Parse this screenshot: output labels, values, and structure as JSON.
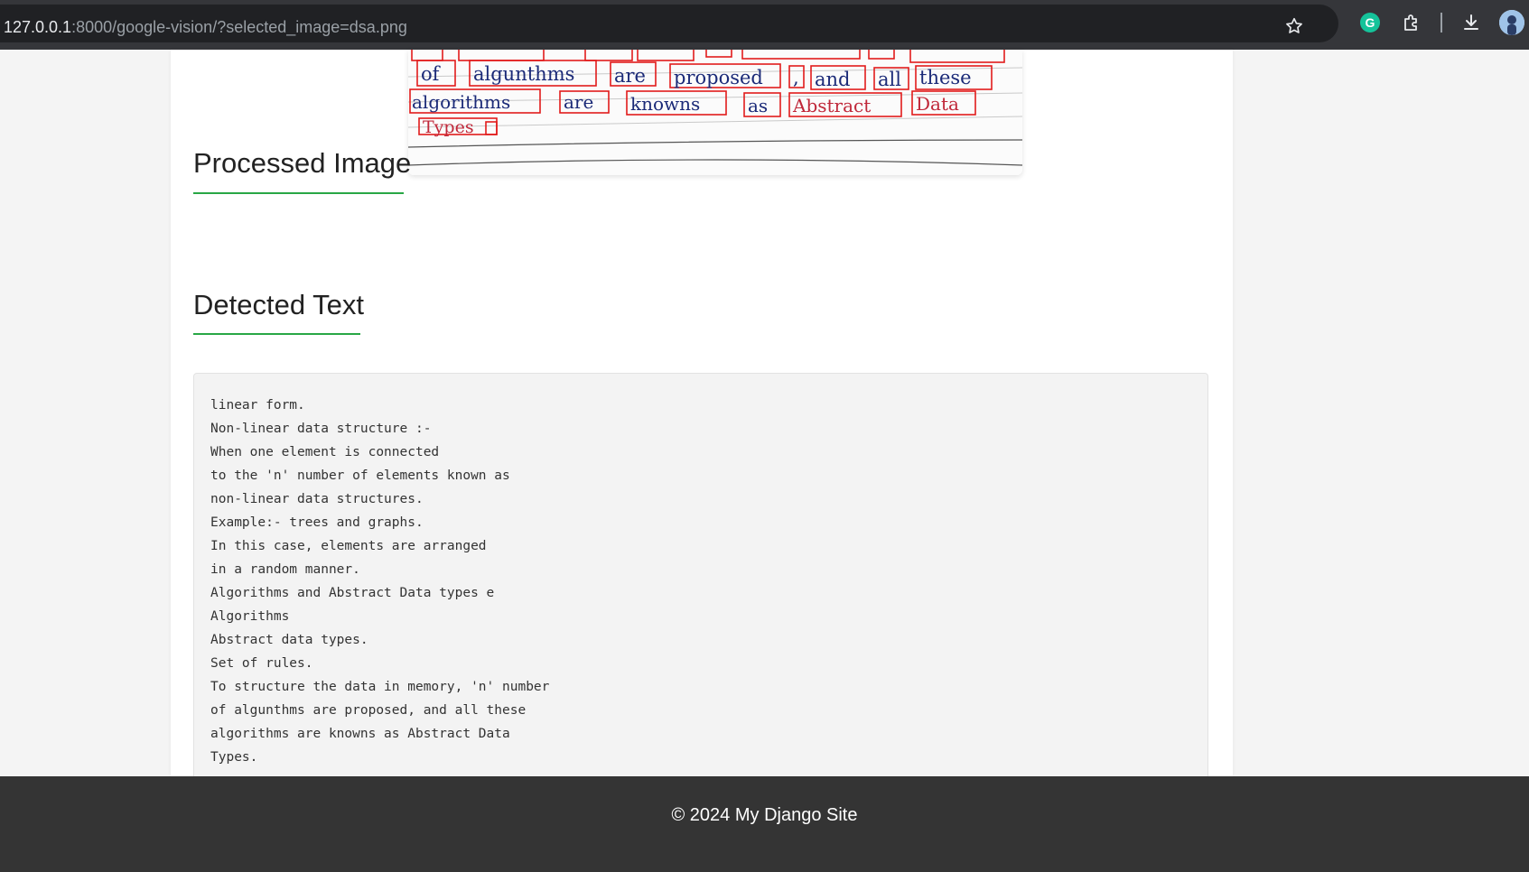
{
  "browser": {
    "url_host": "127.0.0.1",
    "url_rest": ":8000/google-vision/?selected_image=dsa.png"
  },
  "processed_image": {
    "heading": "Processed Image",
    "handwriting_lines": [
      [
        "of",
        "algunthms",
        "are",
        "proposed",
        ",",
        "and",
        "all",
        "these"
      ],
      [
        "algorithms",
        "are",
        "knowns",
        "as",
        "Abstract",
        "Data"
      ],
      [
        "Types"
      ]
    ],
    "box_color": "#e21b1b",
    "ink_color": "#1b2a78"
  },
  "detected_text": {
    "heading": "Detected Text",
    "lines": [
      "linear form.",
      "Non-linear data structure :-",
      "When one element is connected",
      "to the 'n' number of elements known as",
      "non-linear data structures.",
      "Example:- trees and graphs.",
      "In this case, elements are arranged",
      "in a random manner.",
      "Algorithms and Abstract Data types e",
      "Algorithms",
      "Abstract data types.",
      "Set of rules.",
      "To structure the data in memory, 'n' number",
      "of algunthms are proposed, and all these",
      "algorithms are knowns as Abstract Data",
      "Types."
    ]
  },
  "footer": {
    "text": "© 2024 My Django Site"
  },
  "colors": {
    "accent_underline": "#28a745",
    "footer_bg": "#343434",
    "browser_bar": "#35363a"
  }
}
